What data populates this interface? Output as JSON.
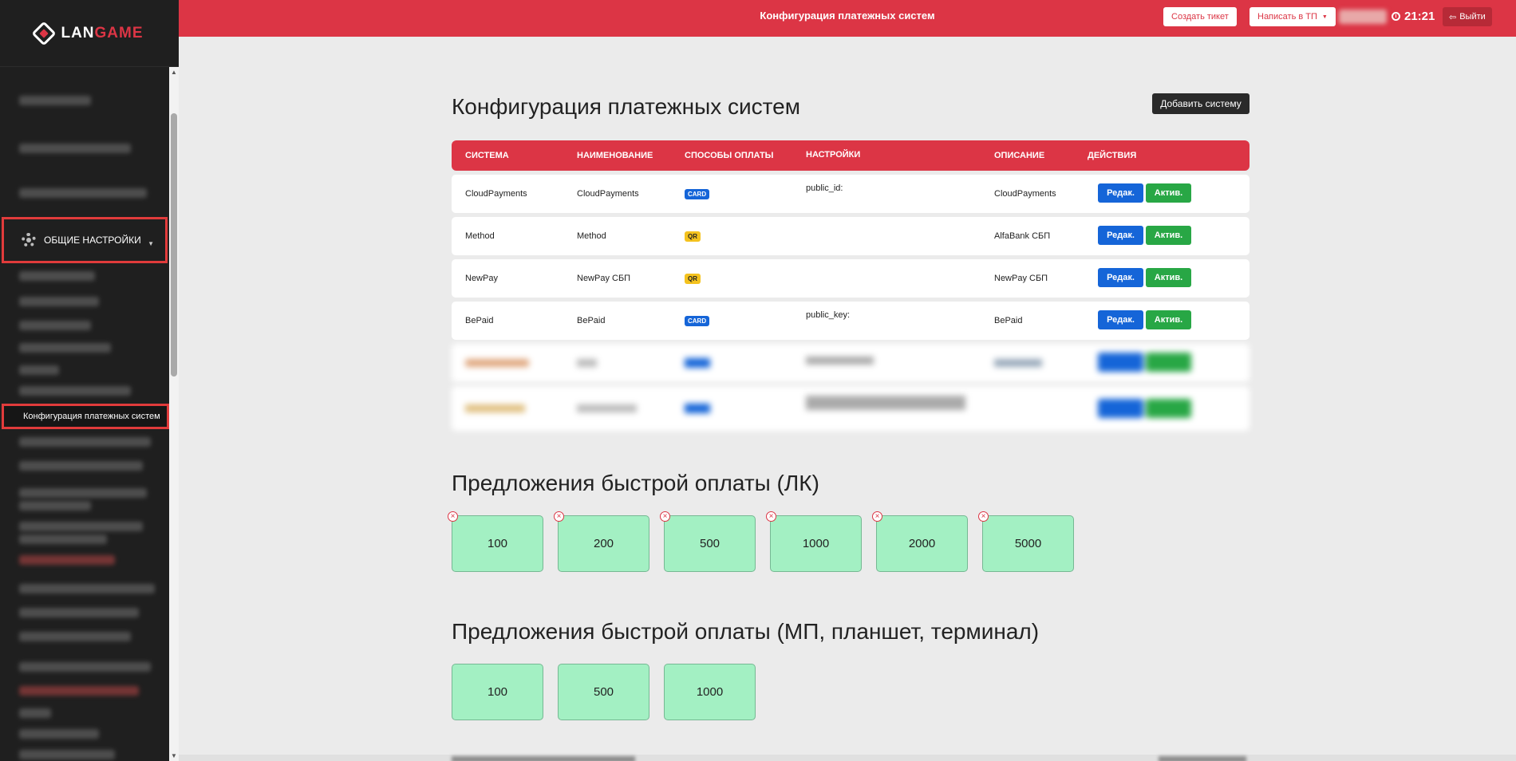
{
  "brand": {
    "logo_main": "LAN",
    "logo_accent": "GAME"
  },
  "header": {
    "title": "Конфигурация платежных систем",
    "create_ticket": "Создать тикет",
    "write_support": "Написать в ТП",
    "time": "21:21",
    "logout": "Выйти"
  },
  "sidebar": {
    "active_section": "ОБЩИЕ НАСТРОЙКИ",
    "active_item": "Конфигурация платежных систем"
  },
  "page": {
    "title": "Конфигурация платежных систем",
    "add_system": "Добавить систему"
  },
  "table": {
    "headers": [
      "СИСТЕМА",
      "НАИМЕНОВАНИЕ",
      "СПОСОБЫ ОПЛАТЫ",
      "НАСТРОЙКИ",
      "ОПИСАНИЕ",
      "ДЕЙСТВИЯ"
    ],
    "edit_label": "Редак.",
    "activate_label": "Актив.",
    "rows": [
      {
        "system": "CloudPayments",
        "name": "CloudPayments",
        "method": "CARD",
        "settings": "public_id:",
        "description": "CloudPayments"
      },
      {
        "system": "Method",
        "name": "Method",
        "method": "QR",
        "settings": "",
        "description": "AlfaBank СБП"
      },
      {
        "system": "NewPay",
        "name": "NewPay СБП",
        "method": "QR",
        "settings": "",
        "description": "NewPay СБП"
      },
      {
        "system": "BePaid",
        "name": "BePaid",
        "method": "CARD",
        "settings": "public_key:",
        "description": "BePaid"
      }
    ]
  },
  "quick_lk": {
    "title": "Предложения быстрой оплаты (ЛК)",
    "amounts": [
      "100",
      "200",
      "500",
      "1000",
      "2000",
      "5000"
    ]
  },
  "quick_mp": {
    "title": "Предложения быстрой оплаты (МП, планшет, терминал)",
    "amounts": [
      "100",
      "500",
      "1000"
    ]
  },
  "icons": {
    "remove": "x-circle-icon",
    "settings": "gear-icon",
    "clock": "clock-icon",
    "logout": "sign-out-icon"
  },
  "colors": {
    "accent": "#dc3545",
    "primary": "#1565d8",
    "success": "#28a745",
    "tile": "#a3f0c3",
    "sidebar": "#1f1f1f"
  }
}
